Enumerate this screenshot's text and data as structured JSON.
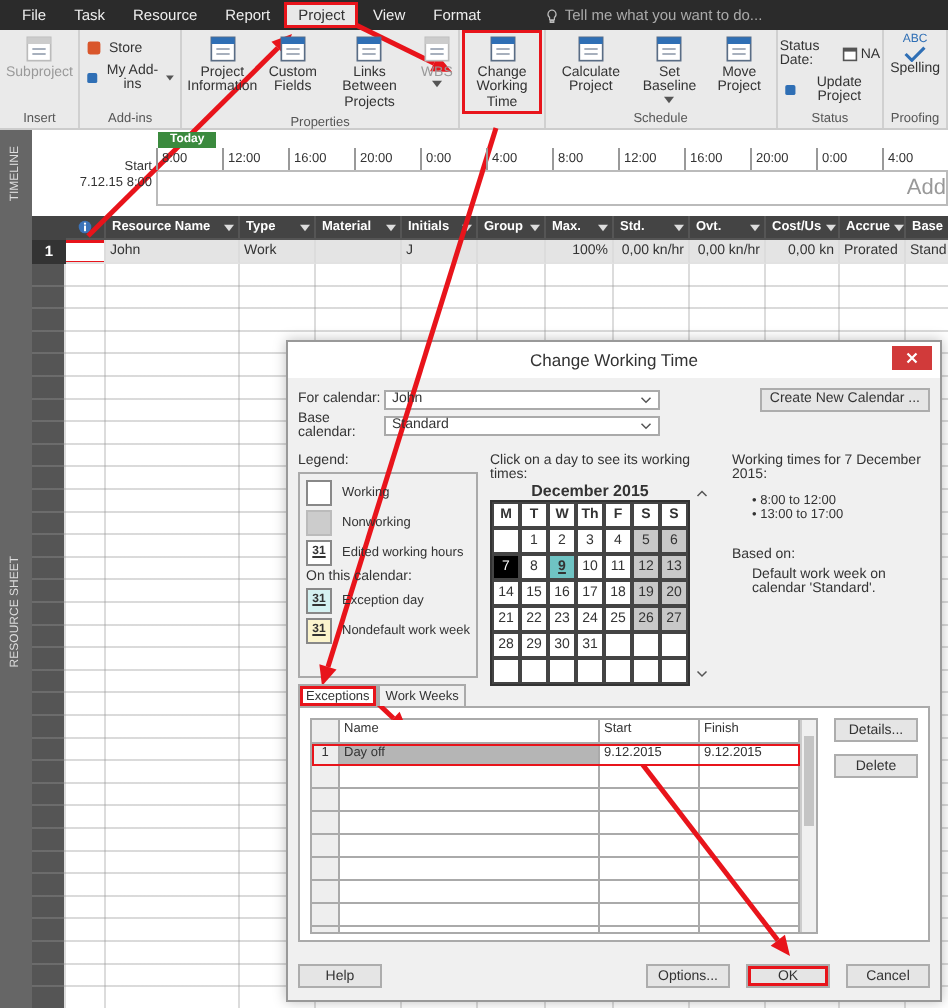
{
  "menu_tabs": [
    {
      "label": "File",
      "selected": false,
      "annotated": false
    },
    {
      "label": "Task",
      "selected": false,
      "annotated": false
    },
    {
      "label": "Resource",
      "selected": false,
      "annotated": false
    },
    {
      "label": "Report",
      "selected": false,
      "annotated": false
    },
    {
      "label": "Project",
      "selected": true,
      "annotated": true
    },
    {
      "label": "View",
      "selected": false,
      "annotated": false
    },
    {
      "label": "Format",
      "selected": false,
      "annotated": false
    }
  ],
  "tell_me": {
    "placeholder": "Tell me what you want to do..."
  },
  "ribbon": [
    {
      "label": "Insert",
      "buttons": [
        {
          "kind": "large",
          "label": "Subproject",
          "disabled": true
        }
      ]
    },
    {
      "label": "Add-ins",
      "buttons": [
        {
          "kind": "small",
          "label": "Store"
        },
        {
          "kind": "small",
          "label": "My Add-ins",
          "menu": true
        }
      ]
    },
    {
      "label": "Properties",
      "buttons": [
        {
          "kind": "large",
          "label": "Project Information"
        },
        {
          "kind": "large",
          "label": "Custom Fields"
        },
        {
          "kind": "large",
          "label": "Links Between Projects"
        },
        {
          "kind": "large",
          "label": "WBS",
          "menu": true,
          "disabled": true
        }
      ]
    },
    {
      "buttons": [
        {
          "kind": "large",
          "label": "Change Working Time",
          "annotated": true
        }
      ]
    },
    {
      "label": "Schedule",
      "buttons": [
        {
          "kind": "large",
          "label": "Calculate Project"
        },
        {
          "kind": "large",
          "label": "Set Baseline",
          "menu": true
        },
        {
          "kind": "large",
          "label": "Move Project"
        }
      ]
    },
    {
      "label": "Status",
      "buttons": [
        {
          "kind": "status_date",
          "label": "Status Date:",
          "value": "NA"
        },
        {
          "kind": "small",
          "label": "Update Project"
        }
      ]
    },
    {
      "label": "Proofing",
      "buttons": [
        {
          "kind": "spelling",
          "icon_text": "ABC",
          "label": "Spelling"
        }
      ]
    }
  ],
  "timeline": {
    "side_label": "TIMELINE",
    "today": "Today",
    "start_label": "Start",
    "start_date": "7.12.15 8:00",
    "ticks": [
      "8:00",
      "12:00",
      "16:00",
      "20:00",
      "0:00",
      "4:00",
      "8:00",
      "12:00",
      "16:00",
      "20:00",
      "0:00",
      "4:00"
    ],
    "bar_text": "Add"
  },
  "sheet": {
    "side_label": "RESOURCE SHEET",
    "columns": [
      {
        "label": "Resource Name"
      },
      {
        "label": "Type"
      },
      {
        "label": "Material"
      },
      {
        "label": "Initials"
      },
      {
        "label": "Group"
      },
      {
        "label": "Max."
      },
      {
        "label": "Std."
      },
      {
        "label": "Ovt."
      },
      {
        "label": "Cost/Us"
      },
      {
        "label": "Accrue"
      },
      {
        "label": "Base"
      }
    ],
    "rows": [
      {
        "number": "1",
        "annotated": true,
        "cells": [
          {
            "kind": "text",
            "text": "John"
          },
          {
            "kind": "text",
            "text": "Work"
          },
          {
            "kind": "blank"
          },
          {
            "kind": "text",
            "text": "J"
          },
          {
            "kind": "blank"
          },
          {
            "kind": "text",
            "text": "100%"
          },
          {
            "kind": "text",
            "text": "0,00 kn/hr"
          },
          {
            "kind": "text",
            "text": "0,00 kn/hr"
          },
          {
            "kind": "text",
            "text": "0,00 kn"
          },
          {
            "kind": "text",
            "text": "Prorated"
          },
          {
            "kind": "text",
            "text": "Stand"
          }
        ]
      }
    ]
  },
  "dialog": {
    "title": "Change Working Time",
    "for_calendar": {
      "label": "For calendar:",
      "value": "John"
    },
    "base_calendar": {
      "label": "Base calendar:",
      "value": "Standard"
    },
    "create_button": "Create New Calendar ...",
    "legend": {
      "title": "Legend:",
      "subtitle": "On this calendar:",
      "items": [
        {
          "kind": "working",
          "label": "Working"
        },
        {
          "kind": "nonworking",
          "label": "Nonworking"
        },
        {
          "kind": "edited",
          "label": "Edited working hours",
          "icon_text": "31"
        }
      ],
      "calendar_items": [
        {
          "kind": "exception",
          "label": "Exception day",
          "icon_text": "31"
        },
        {
          "kind": "nondefault",
          "label": "Nondefault work week",
          "icon_text": "31"
        }
      ]
    },
    "calendar": {
      "hint": "Click on a day to see its working times:",
      "month": "December 2015",
      "weekdays": [
        "M",
        "T",
        "W",
        "Th",
        "F",
        "S",
        "S"
      ],
      "weeks": [
        [
          {
            "kind": "blank"
          },
          {
            "day": "1",
            "kind": "working",
            "selected": false
          },
          {
            "day": "2",
            "kind": "working",
            "selected": false
          },
          {
            "day": "3",
            "kind": "working",
            "selected": false
          },
          {
            "day": "4",
            "kind": "working",
            "selected": false
          },
          {
            "day": "5",
            "kind": "nonworking",
            "selected": false
          },
          {
            "day": "6",
            "kind": "nonworking",
            "selected": false
          }
        ],
        [
          {
            "day": "7",
            "kind": "working",
            "selected": true
          },
          {
            "day": "8",
            "kind": "working",
            "selected": false
          },
          {
            "day": "9",
            "kind": "exception",
            "selected": false
          },
          {
            "day": "10",
            "kind": "working",
            "selected": false
          },
          {
            "day": "11",
            "kind": "working",
            "selected": false
          },
          {
            "day": "12",
            "kind": "nonworking",
            "selected": false
          },
          {
            "day": "13",
            "kind": "nonworking",
            "selected": false
          }
        ],
        [
          {
            "day": "14",
            "kind": "working",
            "selected": false
          },
          {
            "day": "15",
            "kind": "working",
            "selected": false
          },
          {
            "day": "16",
            "kind": "working",
            "selected": false
          },
          {
            "day": "17",
            "kind": "working",
            "selected": false
          },
          {
            "day": "18",
            "kind": "working",
            "selected": false
          },
          {
            "day": "19",
            "kind": "nonworking",
            "selected": false
          },
          {
            "day": "20",
            "kind": "nonworking",
            "selected": false
          }
        ],
        [
          {
            "day": "21",
            "kind": "working",
            "selected": false
          },
          {
            "day": "22",
            "kind": "working",
            "selected": false
          },
          {
            "day": "23",
            "kind": "working",
            "selected": false
          },
          {
            "day": "24",
            "kind": "working",
            "selected": false
          },
          {
            "day": "25",
            "kind": "working",
            "selected": false
          },
          {
            "day": "26",
            "kind": "nonworking",
            "selected": false
          },
          {
            "day": "27",
            "kind": "nonworking",
            "selected": false
          }
        ],
        [
          {
            "day": "28",
            "kind": "working",
            "selected": false
          },
          {
            "day": "29",
            "kind": "working",
            "selected": false
          },
          {
            "day": "30",
            "kind": "working",
            "selected": false
          },
          {
            "day": "31",
            "kind": "working",
            "selected": false
          },
          {
            "kind": "blank"
          },
          {
            "kind": "blank"
          },
          {
            "kind": "blank"
          }
        ],
        [
          {
            "kind": "blank"
          },
          {
            "kind": "blank"
          },
          {
            "kind": "blank"
          },
          {
            "kind": "blank"
          },
          {
            "kind": "blank"
          },
          {
            "kind": "blank"
          },
          {
            "kind": "blank"
          }
        ]
      ]
    },
    "working_times": {
      "title": "Working times for 7 December 2015:",
      "times": [
        "• 8:00 to 12:00",
        "• 13:00 to 17:00"
      ],
      "based_on_label": "Based on:",
      "based_on_text": "Default work week on calendar 'Standard'."
    },
    "tabs": [
      {
        "label": "Exceptions",
        "selected": true,
        "annotated": true
      },
      {
        "label": "Work Weeks",
        "selected": false,
        "annotated": false
      }
    ],
    "exceptions": {
      "columns": [
        "Name",
        "Start",
        "Finish"
      ],
      "rows": [
        {
          "number": "1",
          "name": "Day off",
          "start": "9.12.2015",
          "finish": "9.12.2015",
          "selected": true,
          "annotated": true
        }
      ]
    },
    "side_buttons": [
      "Details...",
      "Delete"
    ],
    "help_button": "Help",
    "footer_buttons": [
      {
        "label": "Options...",
        "annotated": false
      },
      {
        "label": "OK",
        "annotated": true
      },
      {
        "label": "Cancel",
        "annotated": false
      }
    ]
  }
}
